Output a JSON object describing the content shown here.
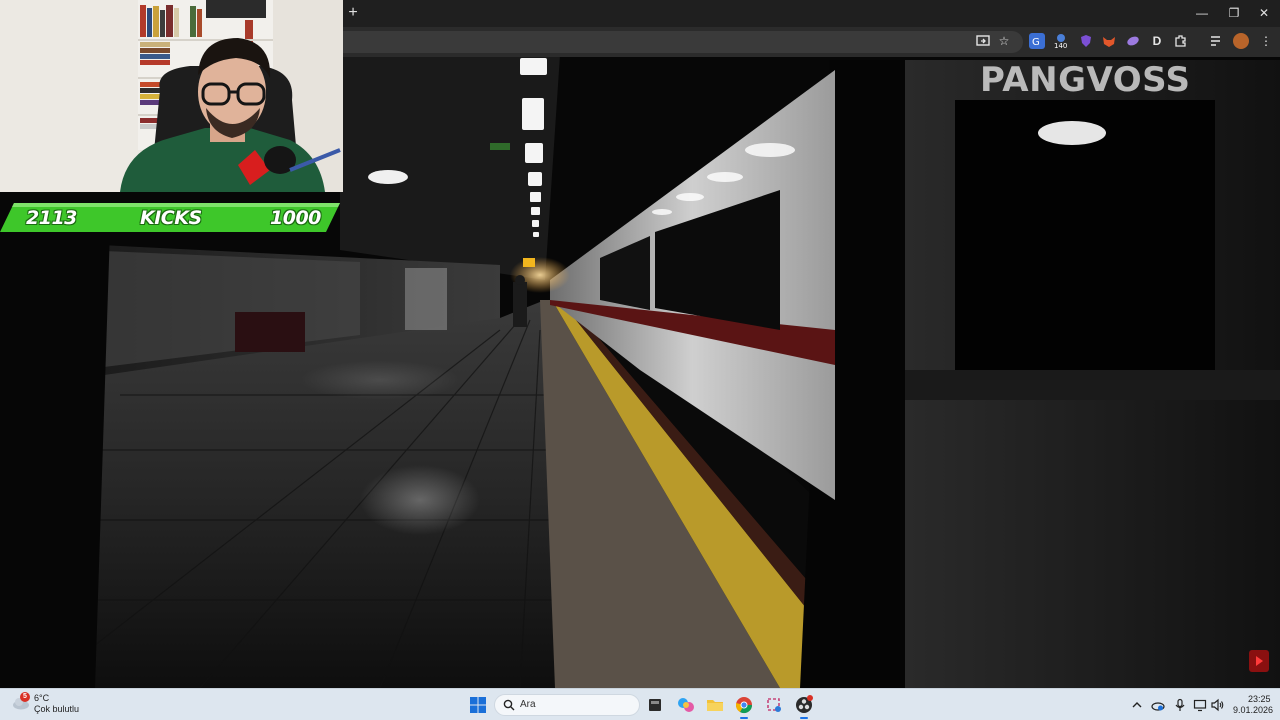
{
  "overlay": {
    "watermark": "PANGVOSS",
    "kicks": {
      "current": "2113",
      "label": "KICKS",
      "goal": "1000"
    }
  },
  "browser": {
    "new_tab_label": "+",
    "window_controls": {
      "minimize": "—",
      "restore": "❐",
      "close": "✕"
    },
    "toolbar_icons": [
      "cast-icon",
      "star-icon",
      "translate-icon",
      "extension-140-icon",
      "shield-extension-icon",
      "fox-extension-icon",
      "purple-extension-icon",
      "d-extension-icon",
      "puzzle-icon",
      "playlist-icon",
      "profile-avatar",
      "more-icon"
    ],
    "extension_badge": "140",
    "d_extension_label": "D"
  },
  "taskbar": {
    "weather": {
      "temperature": "6°C",
      "description": "Çok bulutlu",
      "badge": "5"
    },
    "search_placeholder": "Ara",
    "apps": [
      "file-explorer-icon",
      "copilot-icon",
      "folder-icon",
      "chrome-icon",
      "snipping-tool-icon",
      "obs-icon"
    ],
    "tray": [
      "chevron-up-icon",
      "onedrive-icon",
      "microphone-icon",
      "display-icon",
      "volume-icon"
    ],
    "clock": {
      "time": "23:25",
      "date": "9.01.2026"
    }
  },
  "colors": {
    "kicks_green": "#3ec72a",
    "taskbar_bg": "#dde6ef",
    "browser_dark": "#1f1f1f"
  }
}
